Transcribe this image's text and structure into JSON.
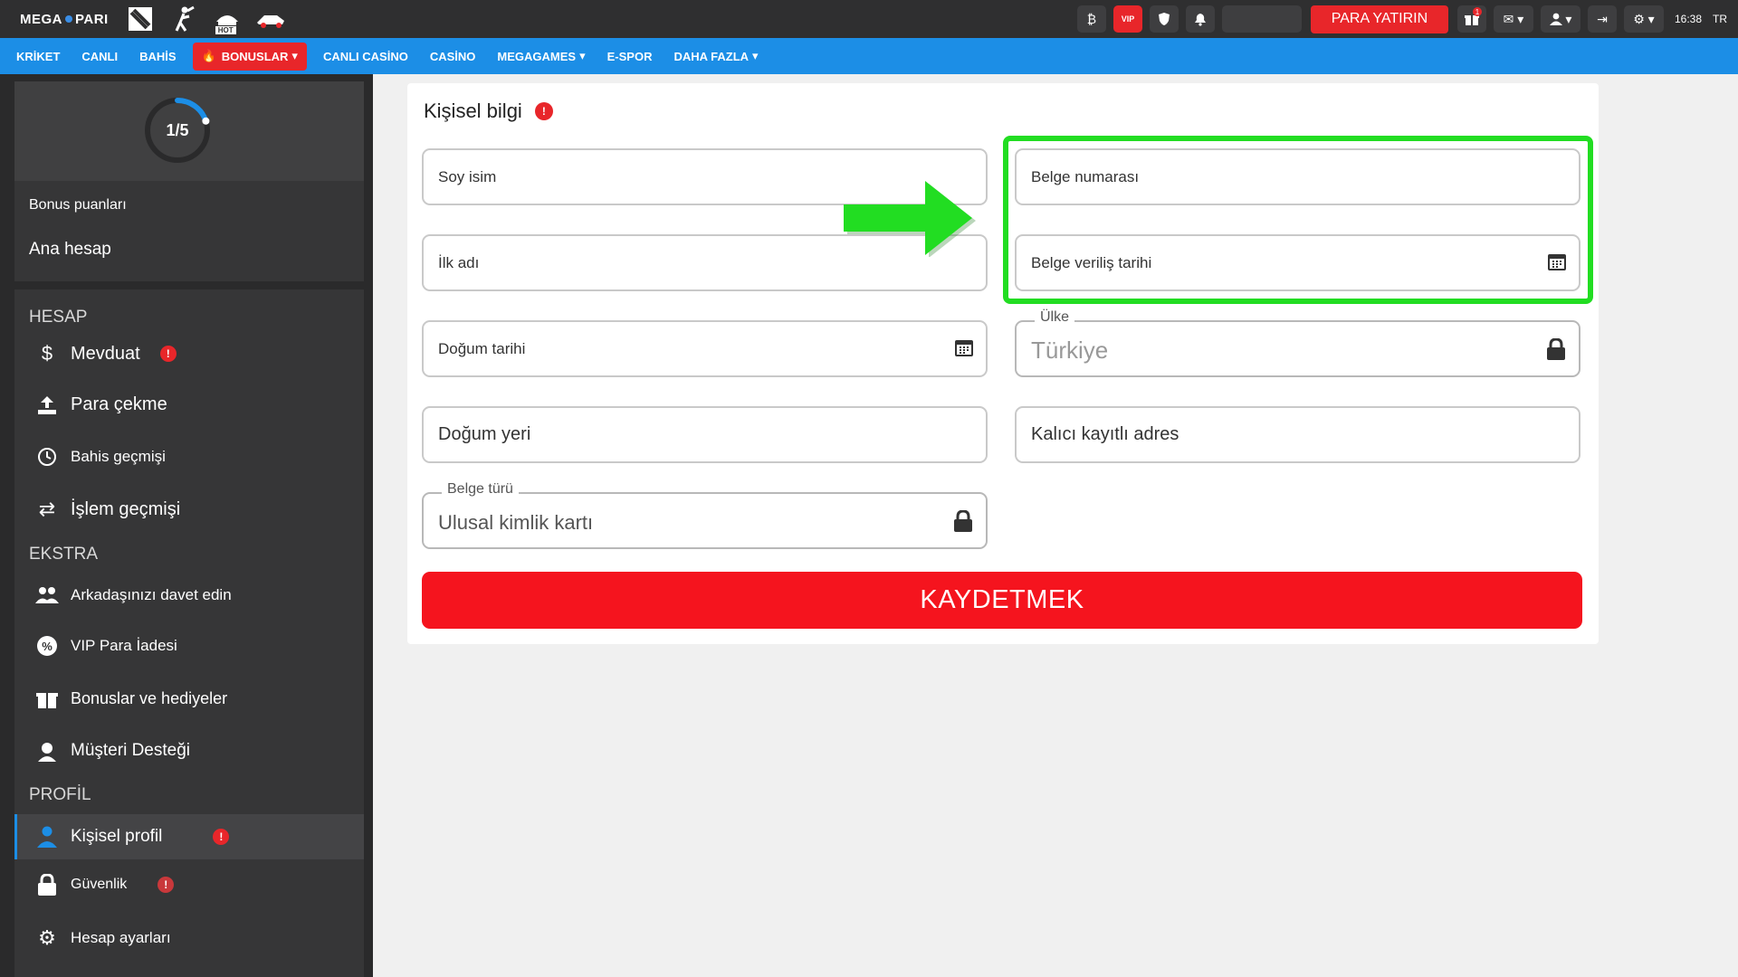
{
  "header": {
    "logo_left": "MEGA",
    "logo_right": "PARI",
    "game_icons": [
      "dota-icon",
      "cricket-icon",
      "hot-games-icon",
      "racing-icon"
    ],
    "hot_label": "HOT",
    "vip_label": "VIP",
    "deposit_button": "PARA YATIRIN",
    "gift_badge": "1",
    "time": "16:38",
    "language": "TR"
  },
  "nav": {
    "items": [
      "KRİKET",
      "CANLI",
      "BAHİS",
      "BONUSLAR",
      "CANLI CASİNO",
      "CASİNO",
      "MEGAGAMES",
      "E-SPOR",
      "DAHA FAZLA"
    ],
    "active_index": 3
  },
  "sidebar": {
    "level": "1/5",
    "level_progress": 0.2,
    "bonus_points_label": "Bonus puanları",
    "main_account_label": "Ana hesap",
    "sections": {
      "hesap": "HESAP",
      "ekstra": "EKSTRA",
      "profil": "PROFİL"
    },
    "items": {
      "deposit": "Mevduat",
      "withdraw": "Para çekme",
      "bet_history": "Bahis geçmişi",
      "tx_history": "İşlem geçmişi",
      "invite": "Arkadaşınızı davet edin",
      "vip_cashback": "VIP Para İadesi",
      "bonuses": "Bonuslar ve hediyeler",
      "support": "Müşteri Desteği",
      "personal_profile": "Kişisel profil",
      "security": "Güvenlik",
      "account_settings": "Hesap ayarları"
    }
  },
  "form": {
    "title": "Kişisel bilgi",
    "surname": "Soy isim",
    "first_name": "İlk adı",
    "birth_date": "Doğum tarihi",
    "birth_place": "Doğum yeri",
    "doc_type_label": "Belge türü",
    "doc_type_value": "Ulusal kimlik kartı",
    "doc_number": "Belge numarası",
    "doc_issue_date": "Belge veriliş tarihi",
    "country_label": "Ülke",
    "country_value": "Türkiye",
    "address": "Kalıcı kayıtlı adres",
    "save_button": "KAYDETMEK"
  },
  "colors": {
    "accent_blue": "#1c8ee6",
    "accent_red": "#e8262a",
    "highlight_green": "#22dd22"
  }
}
